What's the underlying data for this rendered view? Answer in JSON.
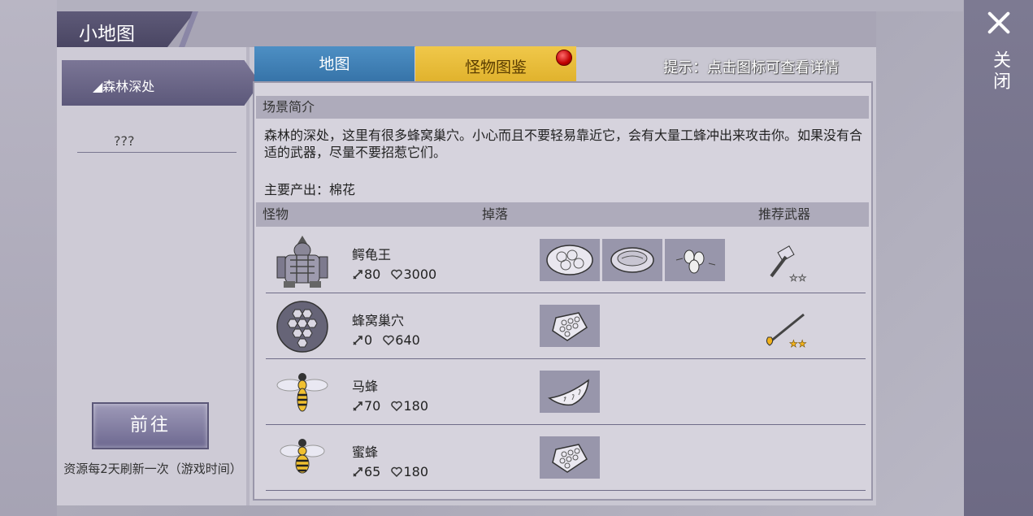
{
  "window": {
    "title": "小地图"
  },
  "close": {
    "label": "关闭"
  },
  "left": {
    "area_tab": "◢森林深处",
    "area_item": "???",
    "go_button": "前往",
    "refresh_note": "资源每2天刷新一次（游戏时间）"
  },
  "tabs": {
    "map": "地图",
    "monster": "怪物图鉴"
  },
  "hint": "提示：点击图标可查看详情",
  "scene": {
    "heading": "场景简介",
    "description": "森林的深处，这里有很多蜂窝巢穴。小心而且不要轻易靠近它，会有大量工蜂冲出来攻击你。如果没有合适的武器，尽量不要招惹它们。",
    "produce": "主要产出：棉花"
  },
  "table": {
    "col_monster": "怪物",
    "col_drop": "掉落",
    "col_weapon": "推荐武器",
    "rows": [
      {
        "name": "鳄龟王",
        "attack": "80",
        "hp": "3000",
        "drops": [
          "cotton-icon",
          "meat-icon",
          "seeds-icon"
        ],
        "weapon": "hammer-icon",
        "stars": 2,
        "stars_filled": 0
      },
      {
        "name": "蜂窝巢穴",
        "attack": "0",
        "hp": "640",
        "drops": [
          "honeycomb-icon"
        ],
        "weapon": "torch-spear-icon",
        "stars": 2,
        "stars_filled": 2
      },
      {
        "name": "马蜂",
        "attack": "70",
        "hp": "180",
        "drops": [
          "horn-icon"
        ],
        "weapon": "",
        "stars": 0,
        "stars_filled": 0
      },
      {
        "name": "蜜蜂",
        "attack": "65",
        "hp": "180",
        "drops": [
          "honeycomb-icon"
        ],
        "weapon": "",
        "stars": 0,
        "stars_filled": 0
      }
    ]
  },
  "colors": {
    "tab_map": "#3f7fb6",
    "tab_monster": "#e6b932",
    "panel_purple": "#5e5a78"
  }
}
